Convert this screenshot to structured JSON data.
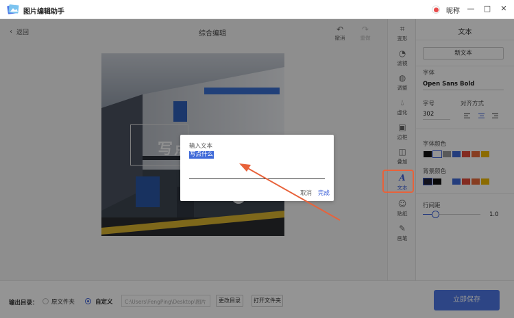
{
  "app": {
    "title": "图片编辑助手",
    "user_name": "昵称"
  },
  "window_controls": {
    "min": "—",
    "max": "□",
    "close": "✕"
  },
  "editor": {
    "back_label": "返回",
    "title": "综合编辑",
    "undo_label": "撤消",
    "redo_label": "重做"
  },
  "tools": [
    {
      "label": "变形",
      "icon": "crop-icon"
    },
    {
      "label": "滤镜",
      "icon": "filter-icon"
    },
    {
      "label": "调整",
      "icon": "adjust-icon"
    },
    {
      "label": "虚化",
      "icon": "blur-icon"
    },
    {
      "label": "边框",
      "icon": "border-icon"
    },
    {
      "label": "叠加",
      "icon": "overlay-icon"
    },
    {
      "label": "文本",
      "icon": "text-icon",
      "active": true
    },
    {
      "label": "贴纸",
      "icon": "sticker-icon"
    },
    {
      "label": "画笔",
      "icon": "brush-icon"
    }
  ],
  "panel": {
    "title": "文本",
    "new_text_label": "新文本",
    "font_label": "字体",
    "font_value": "Open Sans Bold",
    "size_label": "字号",
    "size_value": "302",
    "align_label": "对齐方式",
    "align_selected": "center",
    "font_color_label": "字体颜色",
    "bg_color_label": "背景颜色",
    "line_spacing_label": "行间距",
    "line_spacing_value": "1.0",
    "font_colors": [
      "#111111",
      "#ffffff",
      "#9a9a9a",
      "#3f6ad8",
      "#e24a3a",
      "#e86a3a",
      "#f0b800"
    ],
    "font_color_selected_index": 1,
    "bg_colors": [
      "#222233",
      "#111111",
      "#ffffff",
      "#3f6ad8",
      "#e24a3a",
      "#e86a3a",
      "#f0b800"
    ],
    "bg_color_selected_index": 0
  },
  "canvas": {
    "ghost_text": "写点"
  },
  "dialog": {
    "title": "输入文本",
    "input_value": "写点什么",
    "cancel_label": "取消",
    "ok_label": "完成"
  },
  "bottom": {
    "output_label": "输出目录：",
    "option_original": "原文件夹",
    "option_custom": "自定义",
    "custom_selected": true,
    "path_value": "C:\\Users\\FengPing\\Desktop\\图片",
    "change_dir_label": "更改目录",
    "open_folder_label": "打开文件夹",
    "save_label": "立即保存"
  },
  "colors": {
    "accent": "#3f63d9",
    "highlight": "#e8623a",
    "save_button": "#4e78e6"
  }
}
